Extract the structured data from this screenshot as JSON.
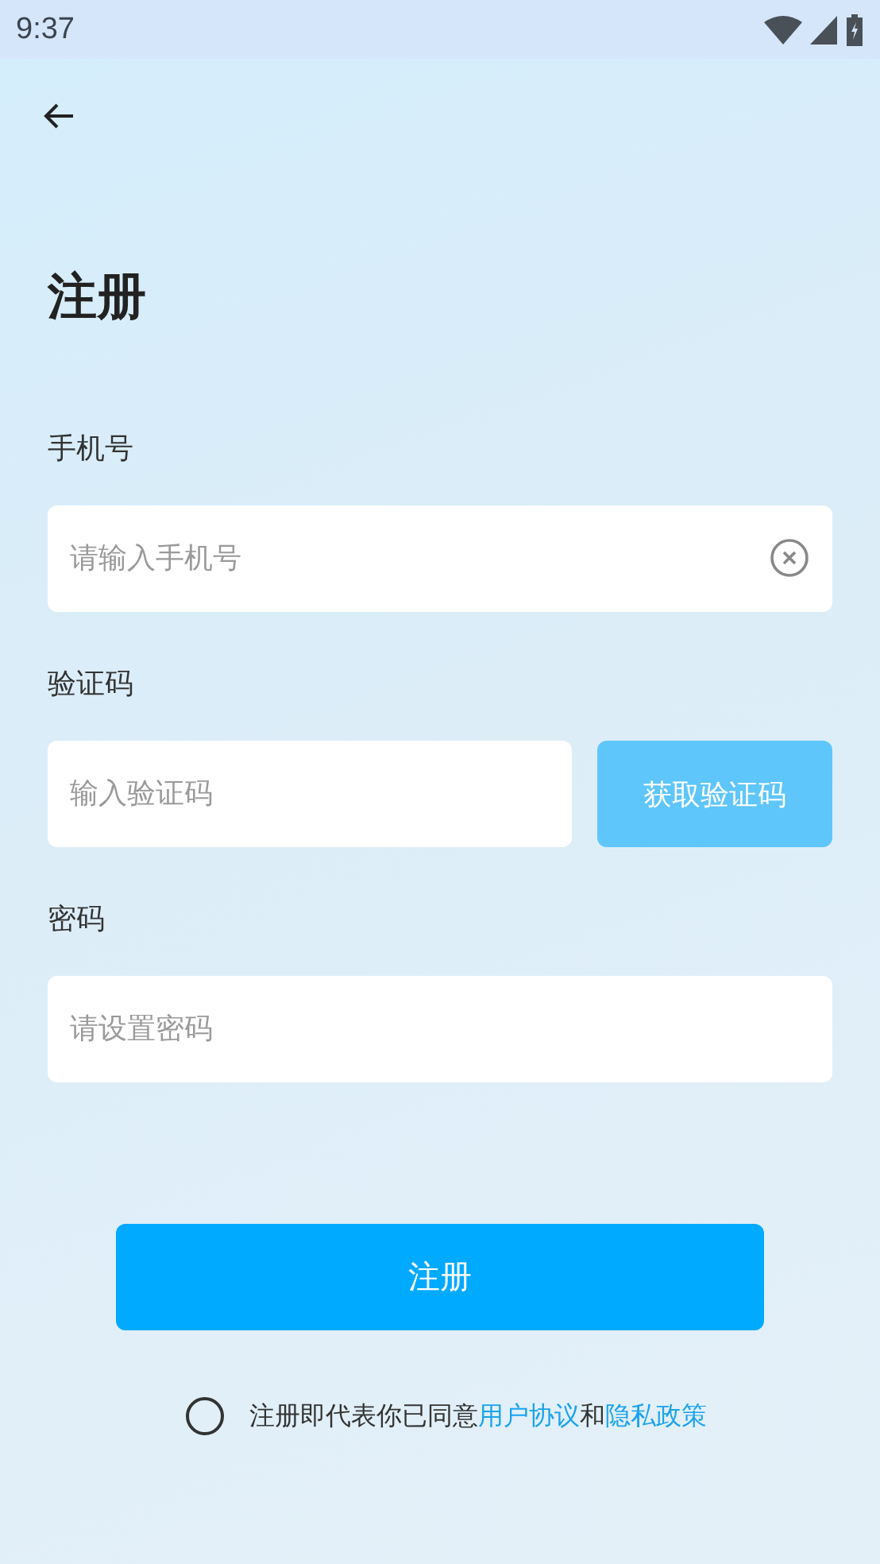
{
  "status_bar": {
    "time": "9:37"
  },
  "title": "注册",
  "fields": [
    {
      "label": "手机号",
      "placeholder": "请输入手机号",
      "clearable": true,
      "kind": "text"
    },
    {
      "label": "验证码",
      "placeholder": "输入验证码",
      "kind": "code",
      "button": "获取验证码"
    },
    {
      "label": "密码",
      "placeholder": "请设置密码",
      "kind": "password"
    }
  ],
  "submit": "注册",
  "agreement": {
    "checked": false,
    "parts": [
      {
        "text": "注册即代表你已同意",
        "kind": "text"
      },
      {
        "text": "用户协议",
        "kind": "link"
      },
      {
        "text": "和",
        "kind": "text"
      },
      {
        "text": "隐私政策",
        "kind": "link"
      }
    ]
  }
}
